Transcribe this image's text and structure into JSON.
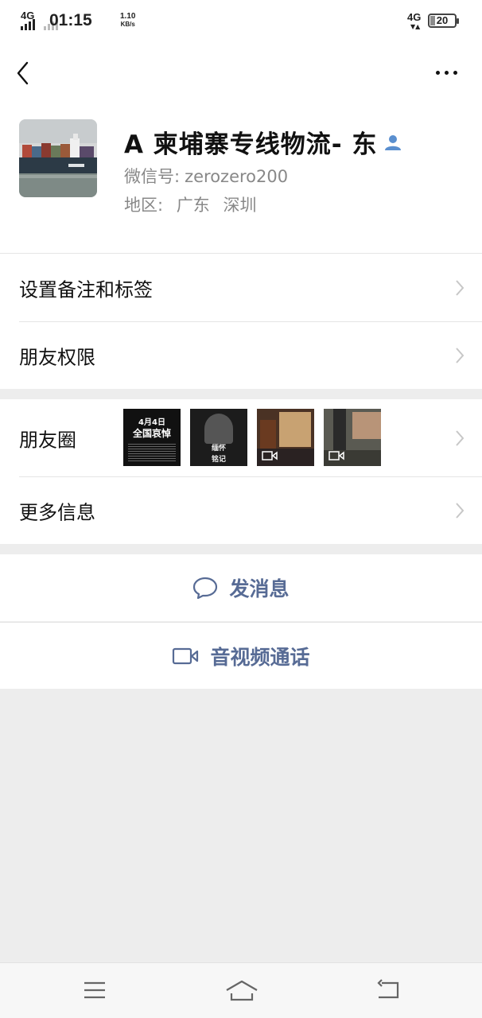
{
  "status_bar": {
    "network_left": "4G",
    "time": "01:15",
    "speed_value": "1.10",
    "speed_unit": "KB/s",
    "network_right": "4G",
    "battery": "20"
  },
  "profile": {
    "name": "A 柬埔寨专线物流- 东",
    "wechat_id_label": "微信号:",
    "wechat_id": "zerozero200",
    "region_label": "地区:",
    "region_province": "广东",
    "region_city": "深圳"
  },
  "menu": {
    "remark_tags": "设置备注和标签",
    "friend_permissions": "朋友权限",
    "moments": "朋友圈",
    "more_info": "更多信息"
  },
  "moments_thumbs": [
    {
      "line1": "4月4日",
      "line2": "全国哀悼"
    },
    {
      "line1": "缅怀",
      "line2": "铭记"
    },
    {
      "icon": "video-icon"
    },
    {
      "icon": "video-icon"
    }
  ],
  "actions": {
    "send_message": "发消息",
    "video_call": "音视频通话"
  },
  "icons": {
    "back": "chevron-left-icon",
    "more": "ellipsis-icon",
    "verified": "person-icon",
    "message": "chat-bubble-icon",
    "video": "video-camera-icon"
  },
  "colors": {
    "accent_link": "#576b95",
    "background": "#ededed",
    "verified_icon": "#5a8fcf"
  }
}
